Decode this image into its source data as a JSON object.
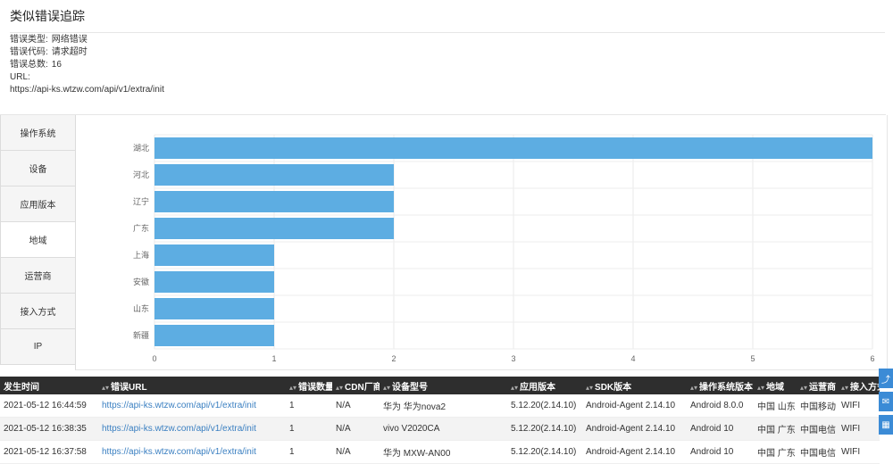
{
  "page": {
    "title": "类似错误追踪"
  },
  "summary": {
    "type_label": "错误类型:",
    "type_value": "网络错误",
    "code_label": "错误代码:",
    "code_value": "请求超时",
    "total_label": "错误总数:",
    "total_value": "16",
    "url_label": "URL:",
    "url_value": "https://api-ks.wtzw.com/api/v1/extra/init"
  },
  "tabs": [
    {
      "label": "操作系统"
    },
    {
      "label": "设备"
    },
    {
      "label": "应用版本"
    },
    {
      "label": "地域"
    },
    {
      "label": "运营商"
    },
    {
      "label": "接入方式"
    },
    {
      "label": "IP"
    }
  ],
  "active_tab": "地域",
  "colors": {
    "bar": "#5dade2",
    "header_bg": "#2e2e2e",
    "link": "#3a7fc1",
    "accent": "#3b8bd6"
  },
  "chart_data": {
    "type": "bar",
    "orientation": "horizontal",
    "categories": [
      "湖北",
      "河北",
      "辽宁",
      "广东",
      "上海",
      "安徽",
      "山东",
      "新疆"
    ],
    "values": [
      6,
      2,
      2,
      2,
      1,
      1,
      1,
      1
    ],
    "xlim": [
      0,
      6
    ],
    "xticks": [
      "0",
      "1",
      "2",
      "3",
      "4",
      "5",
      "6"
    ],
    "grid": true
  },
  "table": {
    "columns": [
      "发生时间",
      "错误URL",
      "错误数量",
      "CDN厂商",
      "设备型号",
      "应用版本",
      "SDK版本",
      "操作系统版本",
      "地域",
      "运营商",
      "接入方式"
    ],
    "rows": [
      [
        "2021-05-12 16:44:59",
        "https://api-ks.wtzw.com/api/v1/extra/init",
        "1",
        "N/A",
        "华为 华为nova2",
        "5.12.20(2.14.10)",
        "Android-Agent 2.14.10",
        "Android 8.0.0",
        "中国 山东",
        "中国移动",
        "WIFI"
      ],
      [
        "2021-05-12 16:38:35",
        "https://api-ks.wtzw.com/api/v1/extra/init",
        "1",
        "N/A",
        "vivo V2020CA",
        "5.12.20(2.14.10)",
        "Android-Agent 2.14.10",
        "Android 10",
        "中国 广东",
        "中国电信",
        "WIFI"
      ],
      [
        "2021-05-12 16:37:58",
        "https://api-ks.wtzw.com/api/v1/extra/init",
        "1",
        "N/A",
        "华为 MXW-AN00",
        "5.12.20(2.14.10)",
        "Android-Agent 2.14.10",
        "Android 10",
        "中国 广东",
        "中国电信",
        "WIFI"
      ]
    ]
  },
  "floating_buttons": [
    {
      "icon": "share-icon"
    },
    {
      "icon": "chat-icon"
    },
    {
      "icon": "qrcode-icon"
    }
  ]
}
